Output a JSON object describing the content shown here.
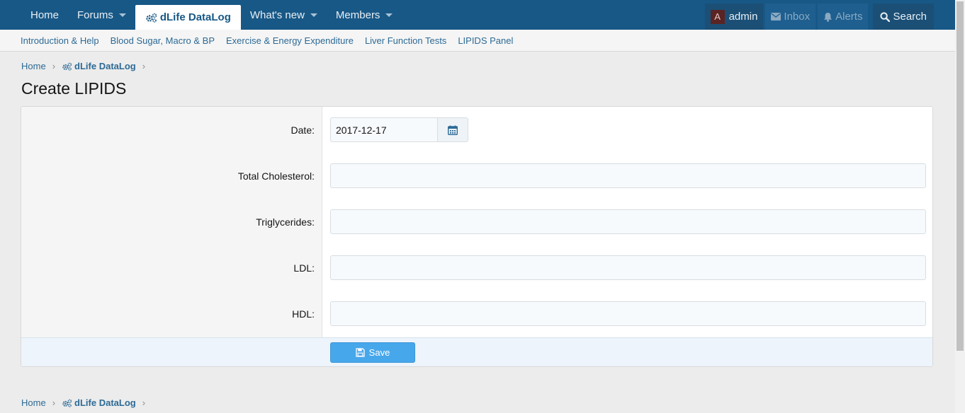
{
  "topnav": {
    "tabs": [
      {
        "label": "Home"
      },
      {
        "label": "Forums"
      },
      {
        "label": "dLife DataLog"
      },
      {
        "label": "What's new"
      },
      {
        "label": "Members"
      }
    ],
    "user": {
      "avatar_letter": "A",
      "name": "admin"
    },
    "inbox_label": "Inbox",
    "alerts_label": "Alerts",
    "search_label": "Search"
  },
  "subnav": {
    "items": [
      "Introduction & Help",
      "Blood Sugar, Macro & BP",
      "Exercise & Energy Expenditure",
      "Liver Function Tests",
      "LIPIDS Panel"
    ]
  },
  "breadcrumb": {
    "home": "Home",
    "section": "dLife DataLog"
  },
  "page": {
    "title": "Create LIPIDS"
  },
  "form": {
    "date_label": "Date:",
    "date_value": "2017-12-17",
    "total_cholesterol_label": "Total Cholesterol:",
    "triglycerides_label": "Triglycerides:",
    "ldl_label": "LDL:",
    "hdl_label": "HDL:",
    "save_label": "Save"
  },
  "colors": {
    "nav_bg": "#185886",
    "accent": "#2d6a95",
    "save_button": "#47a7eb"
  }
}
